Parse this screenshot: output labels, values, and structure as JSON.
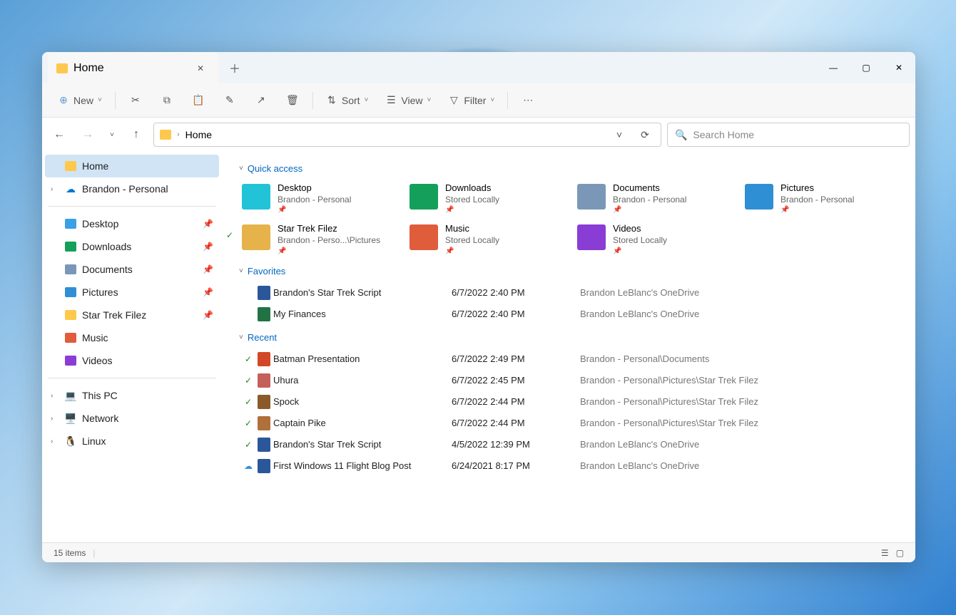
{
  "tab": {
    "title": "Home"
  },
  "toolbar": {
    "new": "New",
    "sort": "Sort",
    "view": "View",
    "filter": "Filter"
  },
  "breadcrumb": {
    "location": "Home"
  },
  "search": {
    "placeholder": "Search Home"
  },
  "sidebar": {
    "home": "Home",
    "onedrive": "Brandon - Personal",
    "pinned": [
      {
        "label": "Desktop"
      },
      {
        "label": "Downloads"
      },
      {
        "label": "Documents"
      },
      {
        "label": "Pictures"
      },
      {
        "label": "Star Trek Filez"
      },
      {
        "label": "Music"
      },
      {
        "label": "Videos"
      }
    ],
    "sys": [
      {
        "label": "This PC"
      },
      {
        "label": "Network"
      },
      {
        "label": "Linux"
      }
    ]
  },
  "sections": {
    "quick": "Quick access",
    "fav": "Favorites",
    "recent": "Recent"
  },
  "quick": [
    {
      "name": "Desktop",
      "sub": "Brandon - Personal",
      "color": "#22c3d6"
    },
    {
      "name": "Downloads",
      "sub": "Stored Locally",
      "color": "#14a05a"
    },
    {
      "name": "Documents",
      "sub": "Brandon - Personal",
      "color": "#7a97b8"
    },
    {
      "name": "Pictures",
      "sub": "Brandon - Personal",
      "color": "#2f8fd4"
    },
    {
      "name": "Star Trek Filez",
      "sub": "Brandon - Perso...\\Pictures",
      "color": "#e6b24a",
      "synced": true
    },
    {
      "name": "Music",
      "sub": "Stored Locally",
      "color": "#e05d3c"
    },
    {
      "name": "Videos",
      "sub": "Stored Locally",
      "color": "#8a3dd4"
    }
  ],
  "favorites": [
    {
      "name": "Brandon's Star Trek Script",
      "date": "6/7/2022 2:40 PM",
      "loc": "Brandon LeBlanc's OneDrive",
      "color": "#2b579a"
    },
    {
      "name": "My Finances",
      "date": "6/7/2022 2:40 PM",
      "loc": "Brandon LeBlanc's OneDrive",
      "color": "#217346"
    }
  ],
  "recent": [
    {
      "name": "Batman Presentation",
      "date": "6/7/2022 2:49 PM",
      "loc": "Brandon - Personal\\Documents",
      "status": "synced",
      "color": "#d24726"
    },
    {
      "name": "Uhura",
      "date": "6/7/2022 2:45 PM",
      "loc": "Brandon - Personal\\Pictures\\Star Trek Filez",
      "status": "synced",
      "color": "#c4605a"
    },
    {
      "name": "Spock",
      "date": "6/7/2022 2:44 PM",
      "loc": "Brandon - Personal\\Pictures\\Star Trek Filez",
      "status": "synced",
      "color": "#8a5a2a"
    },
    {
      "name": "Captain Pike",
      "date": "6/7/2022 2:44 PM",
      "loc": "Brandon - Personal\\Pictures\\Star Trek Filez",
      "status": "synced",
      "color": "#b0703a"
    },
    {
      "name": "Brandon's Star Trek Script",
      "date": "4/5/2022 12:39 PM",
      "loc": "Brandon LeBlanc's OneDrive",
      "status": "synced",
      "color": "#2b579a"
    },
    {
      "name": "First Windows 11 Flight Blog Post",
      "date": "6/24/2021 8:17 PM",
      "loc": "Brandon LeBlanc's OneDrive",
      "status": "cloud",
      "color": "#2b579a"
    }
  ],
  "status": {
    "count": "15 items"
  }
}
